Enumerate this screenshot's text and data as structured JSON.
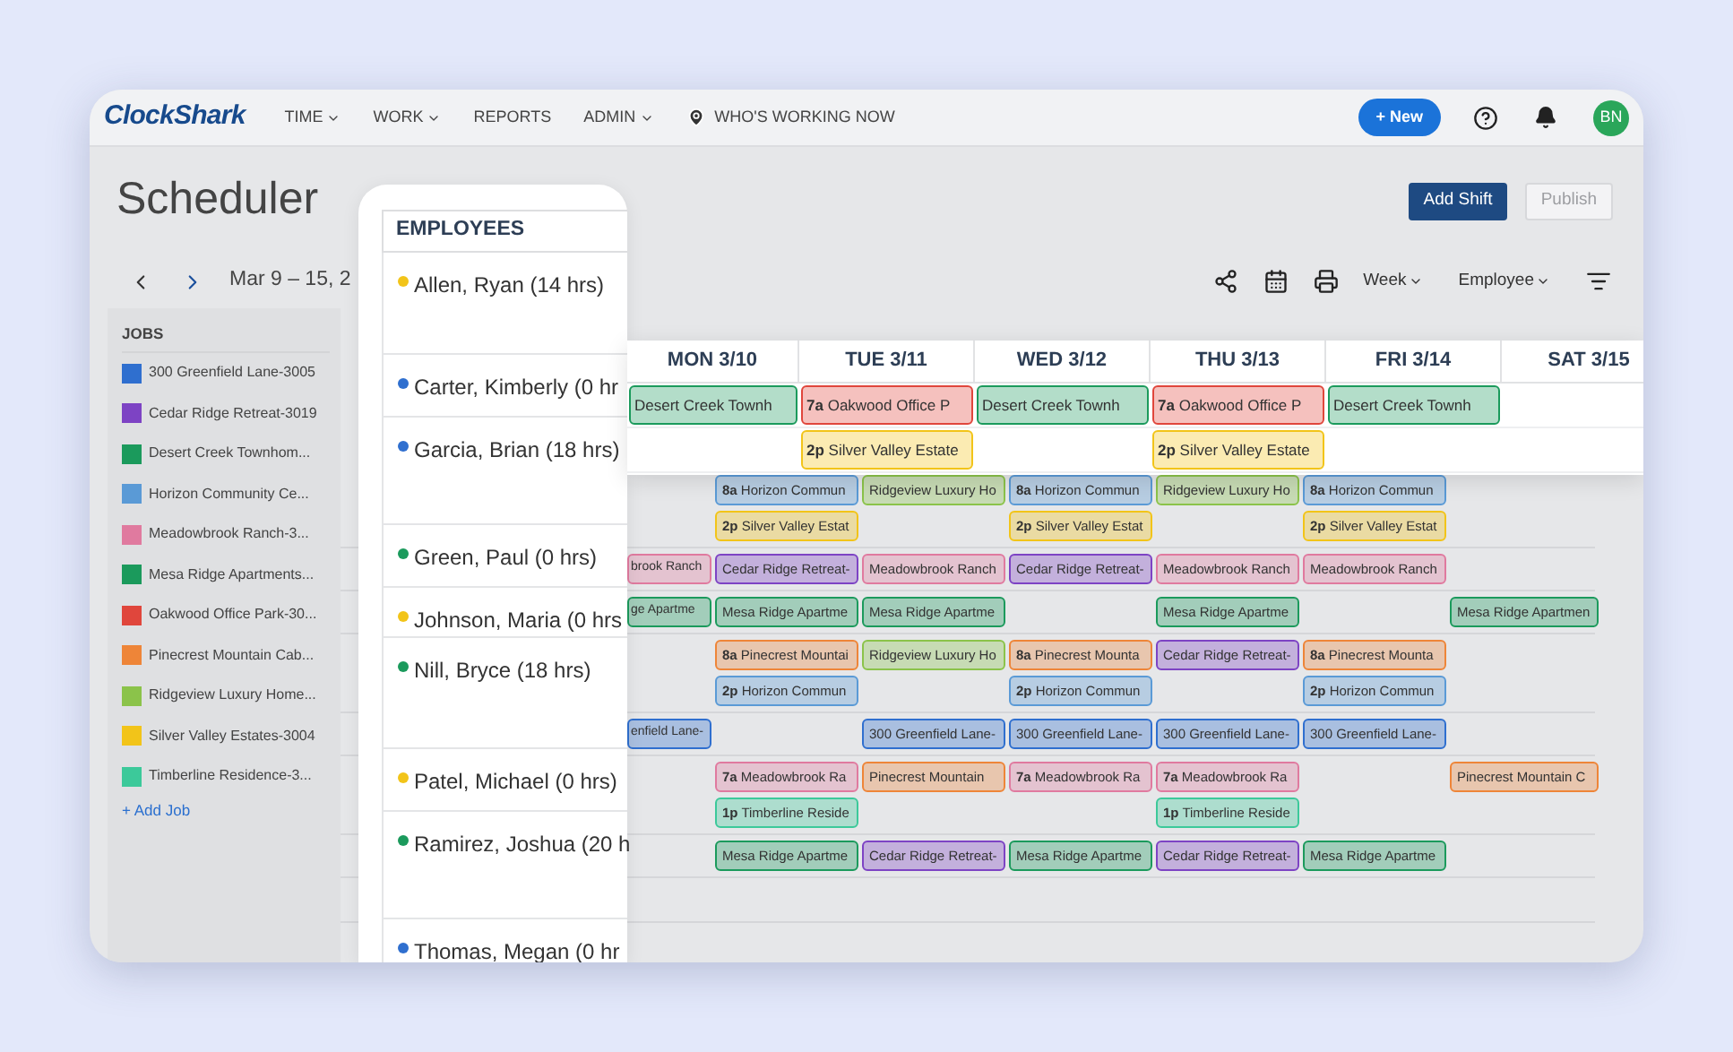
{
  "nav": {
    "logo": "ClockShark",
    "items": [
      {
        "label": "TIME",
        "kind": "menu"
      },
      {
        "label": "WORK",
        "kind": "menu"
      },
      {
        "label": "REPORTS",
        "kind": "link"
      },
      {
        "label": "ADMIN",
        "kind": "menu"
      },
      {
        "label": "WHO'S WORKING NOW",
        "kind": "location"
      }
    ],
    "new_button": "+ New",
    "avatar": "BN"
  },
  "page": {
    "title": "Scheduler",
    "date_range": "Mar 9 – 15, 2",
    "add_shift": "Add Shift",
    "publish": {
      "label": "Publish",
      "disabled": true
    },
    "view": "Week",
    "group_by": "Employee"
  },
  "jobs": {
    "title": "JOBS",
    "items": [
      {
        "name": "300 Greenfield Lane-3005",
        "color": "#2f6fcf"
      },
      {
        "name": "Cedar Ridge Retreat-3019",
        "color": "#7d43c4"
      },
      {
        "name": "Desert Creek Townhom...",
        "color": "#1b9a5c"
      },
      {
        "name": "Horizon Community Ce...",
        "color": "#5a9ad6"
      },
      {
        "name": "Meadowbrook Ranch-3...",
        "color": "#e07a9f"
      },
      {
        "name": "Mesa Ridge Apartments...",
        "color": "#1b9a5c"
      },
      {
        "name": "Oakwood Office Park-30...",
        "color": "#e0463c"
      },
      {
        "name": "Pinecrest Mountain Cab...",
        "color": "#ee8538"
      },
      {
        "name": "Ridgeview Luxury Home...",
        "color": "#8bc34a"
      },
      {
        "name": "Silver Valley Estates-3004",
        "color": "#f2c419"
      },
      {
        "name": "Timberline Residence-3...",
        "color": "#3cc99a"
      }
    ],
    "add_link": "+ Add Job"
  },
  "grid": {
    "rows": [
      {
        "lines": [
          {
            "mon": {
              "text": "**8a** Horizon Commun",
              "color": "#5a9ad6"
            },
            "tue": {
              "text": "Ridgeview Luxury Ho",
              "color": "#8bc34a"
            },
            "wed": {
              "text": "**8a** Horizon Commun",
              "color": "#5a9ad6"
            },
            "thu": {
              "text": "Ridgeview Luxury Ho",
              "color": "#8bc34a"
            },
            "fri": {
              "text": "**8a** Horizon Commun",
              "color": "#5a9ad6"
            }
          },
          {
            "mon": {
              "text": "**2p** Silver Valley Estat",
              "color": "#f2c419"
            },
            "wed": {
              "text": "**2p** Silver Valley Estat",
              "color": "#f2c419"
            },
            "fri": {
              "text": "**2p** Silver Valley Estat",
              "color": "#f2c419"
            }
          }
        ]
      },
      {
        "lines": [
          {
            "sun": {
              "text": "brook Ranch",
              "color": "#e07a9f"
            },
            "mon": {
              "text": "Cedar Ridge Retreat-",
              "color": "#7d43c4"
            },
            "tue": {
              "text": "Meadowbrook Ranch",
              "color": "#e07a9f"
            },
            "wed": {
              "text": "Cedar Ridge Retreat-",
              "color": "#7d43c4"
            },
            "thu": {
              "text": "Meadowbrook Ranch",
              "color": "#e07a9f"
            },
            "fri": {
              "text": "Meadowbrook Ranch",
              "color": "#e07a9f"
            }
          }
        ]
      },
      {
        "lines": [
          {
            "sun": {
              "text": "ge Apartme",
              "color": "#1b9a5c"
            },
            "mon": {
              "text": "Mesa Ridge Apartme",
              "color": "#1b9a5c"
            },
            "tue": {
              "text": "Mesa Ridge Apartme",
              "color": "#1b9a5c"
            },
            "thu": {
              "text": "Mesa Ridge Apartme",
              "color": "#1b9a5c"
            },
            "sat": {
              "text": "Mesa Ridge Apartmen",
              "color": "#1b9a5c"
            }
          }
        ]
      },
      {
        "lines": [
          {
            "mon": {
              "text": "**8a** Pinecrest Mountai",
              "color": "#ee8538"
            },
            "tue": {
              "text": "Ridgeview Luxury Ho",
              "color": "#8bc34a"
            },
            "wed": {
              "text": "**8a** Pinecrest Mounta",
              "color": "#ee8538"
            },
            "thu": {
              "text": "Cedar Ridge Retreat-",
              "color": "#7d43c4"
            },
            "fri": {
              "text": "**8a** Pinecrest Mounta",
              "color": "#ee8538"
            }
          },
          {
            "mon": {
              "text": "**2p** Horizon Commun",
              "color": "#5a9ad6"
            },
            "wed": {
              "text": "**2p** Horizon Commun",
              "color": "#5a9ad6"
            },
            "fri": {
              "text": "**2p** Horizon Commun",
              "color": "#5a9ad6"
            }
          }
        ]
      },
      {
        "lines": [
          {
            "sun": {
              "text": "enfield Lane-",
              "color": "#2f6fcf"
            },
            "tue": {
              "text": "300 Greenfield Lane-",
              "color": "#2f6fcf"
            },
            "wed": {
              "text": "300 Greenfield Lane-",
              "color": "#2f6fcf"
            },
            "thu": {
              "text": "300 Greenfield Lane-",
              "color": "#2f6fcf"
            },
            "fri": {
              "text": "300 Greenfield Lane-",
              "color": "#2f6fcf"
            }
          }
        ]
      },
      {
        "lines": [
          {
            "mon": {
              "text": "**7a** Meadowbrook Ra",
              "color": "#e07a9f"
            },
            "tue": {
              "text": "Pinecrest Mountain",
              "color": "#ee8538"
            },
            "wed": {
              "text": "**7a** Meadowbrook Ra",
              "color": "#e07a9f"
            },
            "thu": {
              "text": "**7a** Meadowbrook Ra",
              "color": "#e07a9f"
            },
            "sat": {
              "text": "Pinecrest Mountain C",
              "color": "#ee8538"
            }
          },
          {
            "mon": {
              "text": "**1p** Timberline Reside",
              "color": "#3cc99a"
            },
            "thu": {
              "text": "**1p** Timberline Reside",
              "color": "#3cc99a"
            }
          }
        ]
      },
      {
        "lines": [
          {
            "mon": {
              "text": "Mesa Ridge Apartme",
              "color": "#1b9a5c"
            },
            "tue": {
              "text": "Cedar Ridge Retreat-",
              "color": "#7d43c4"
            },
            "wed": {
              "text": "Mesa Ridge Apartme",
              "color": "#1b9a5c"
            },
            "thu": {
              "text": "Cedar Ridge Retreat-",
              "color": "#7d43c4"
            },
            "fri": {
              "text": "Mesa Ridge Apartme",
              "color": "#1b9a5c"
            }
          }
        ]
      }
    ]
  },
  "employees": {
    "title": "EMPLOYEES",
    "items": [
      {
        "name": "Allen, Ryan (14 hrs)",
        "color": "#f2c419"
      },
      {
        "name": "Carter, Kimberly (0 hr",
        "color": "#2f6fcf"
      },
      {
        "name": "Garcia, Brian (18 hrs)",
        "color": "#2f6fcf"
      },
      {
        "name": "Green, Paul (0 hrs)",
        "color": "#1b9a5c"
      },
      {
        "name": "Johnson, Maria (0 hrs",
        "color": "#f2c419"
      },
      {
        "name": "Nill, Bryce (18 hrs)",
        "color": "#1b9a5c"
      },
      {
        "name": "Patel, Michael (0 hrs)",
        "color": "#f2c419"
      },
      {
        "name": "Ramirez, Joshua (20 h",
        "color": "#1b9a5c"
      },
      {
        "name": "Thomas, Megan (0 hr",
        "color": "#2f6fcf"
      }
    ]
  },
  "week_view": {
    "days": [
      "MON 3/10",
      "TUE 3/11",
      "WED 3/12",
      "THU 3/13",
      "FRI 3/14",
      "SAT 3/15"
    ],
    "rows": [
      {
        "mon": {
          "text": "Desert Creek Townh",
          "color": "#1b9a5c"
        },
        "tue": {
          "text": "**7a** Oakwood Office P",
          "color": "#e0463c"
        },
        "wed": {
          "text": "Desert Creek Townh",
          "color": "#1b9a5c"
        },
        "thu": {
          "text": "**7a** Oakwood Office P",
          "color": "#e0463c"
        },
        "fri": {
          "text": "Desert Creek Townh",
          "color": "#1b9a5c"
        }
      },
      {
        "tue": {
          "text": "**2p** Silver Valley Estate",
          "color": "#f2c419"
        },
        "thu": {
          "text": "**2p** Silver Valley Estate",
          "color": "#f2c419"
        }
      }
    ]
  }
}
